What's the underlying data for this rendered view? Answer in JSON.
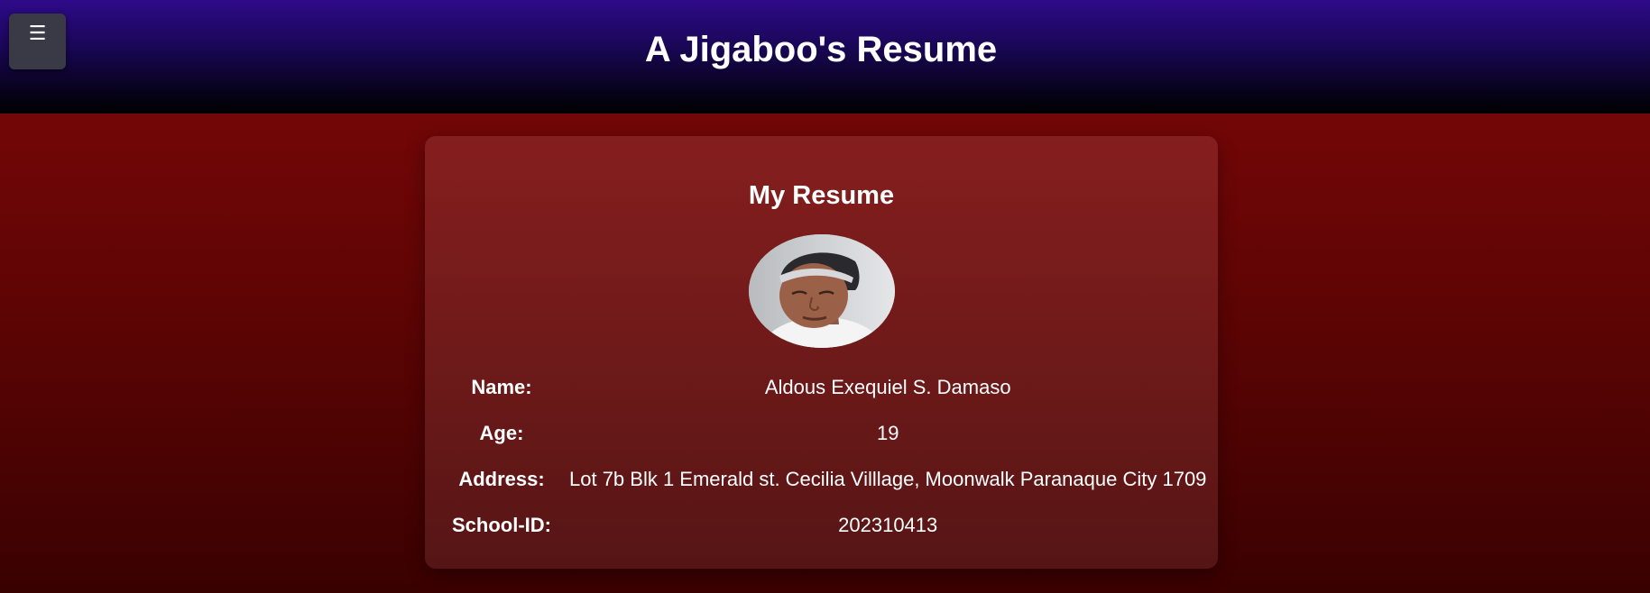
{
  "header": {
    "menu_glyph": "☰",
    "title": "A Jigaboo's Resume"
  },
  "resume": {
    "title": "My Resume",
    "fields": [
      {
        "label": "Name:",
        "value": "Aldous Exequiel S. Damaso"
      },
      {
        "label": "Age:",
        "value": "19"
      },
      {
        "label": "Address:",
        "value": "Lot 7b Blk 1 Emerald st. Cecilia Villlage, Moonwalk Paranaque City 1709"
      },
      {
        "label": "School-ID:",
        "value": "202310413"
      }
    ]
  },
  "colors": {
    "header_top": "#2e0a8a",
    "header_bottom": "#000000",
    "background": "#800808",
    "menu_button": "#3a3a47"
  }
}
